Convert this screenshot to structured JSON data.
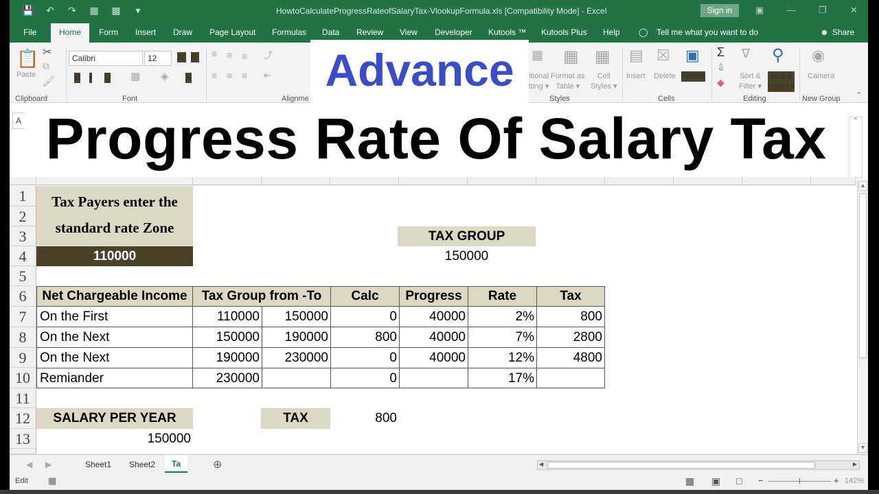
{
  "window": {
    "title": "HowtoCalculateProgressRateofSalaryTax-VlookupFormula.xls  [Compatibility Mode]  -  Excel",
    "sign_in": "Sign in"
  },
  "tabs": [
    "File",
    "Home",
    "Form",
    "Insert",
    "Draw",
    "Page Layout",
    "Formulas",
    "Data",
    "Review",
    "View",
    "Developer",
    "Kutools ™",
    "Kutools Plus",
    "Help"
  ],
  "tell_me": "Tell me what you want to do",
  "share": "Share",
  "ribbon": {
    "paste": "Paste",
    "font_name": "Calibri",
    "font_size": "12",
    "bold": "B",
    "italic": "I",
    "underline": "U",
    "groups": {
      "clipboard": "Clipboard",
      "font": "Font",
      "alignment": "Alignme",
      "styles": "Styles",
      "cells": "Cells",
      "editing": "Editing",
      "new_group": "New Group"
    },
    "conditional": [
      "itional",
      "tting ▾"
    ],
    "format_as_table": [
      "Format as",
      "Table ▾"
    ],
    "cell_styles": [
      "Cell",
      "Styles ▾"
    ],
    "insert": "Insert",
    "delete": "Delete",
    "format": "Format",
    "sort_filter": [
      "Sort &",
      "Filter ▾"
    ],
    "find_select": [
      "Find &",
      "Select ▾"
    ],
    "camera": "Camera"
  },
  "overlay": {
    "advance": "Advance",
    "title": "Progress Rate Of Salary Tax"
  },
  "namebox": "A",
  "rows": [
    "1",
    "2",
    "3",
    "4",
    "5",
    "6",
    "7",
    "8",
    "9",
    "10",
    "11",
    "12",
    "13"
  ],
  "sheet": {
    "intro": [
      "Tax Payers enter the",
      "standard rate Zone"
    ],
    "standard_rate": "110000",
    "tax_group_label": "TAX GROUP",
    "tax_group_value": "150000",
    "table": {
      "headers": [
        "Net Chargeable Income",
        "Tax Group from -To",
        "Calc",
        "Progress",
        "Rate",
        "Tax"
      ],
      "rows": [
        {
          "label": "On the First",
          "from": "110000",
          "to": "150000",
          "calc": "0",
          "progress": "40000",
          "rate": "2%",
          "tax": "800"
        },
        {
          "label": "On the Next",
          "from": "150000",
          "to": "190000",
          "calc": "800",
          "progress": "40000",
          "rate": "7%",
          "tax": "2800"
        },
        {
          "label": "On the Next",
          "from": "190000",
          "to": "230000",
          "calc": "0",
          "progress": "40000",
          "rate": "12%",
          "tax": "4800"
        },
        {
          "label": "Remiander",
          "from": "230000",
          "to": "",
          "calc": "0",
          "progress": "",
          "rate": "17%",
          "tax": ""
        }
      ]
    },
    "salary_label": "SALARY PER YEAR",
    "salary_value": "150000",
    "tax_label": "TAX",
    "tax_value": "800"
  },
  "sheet_tabs": [
    "Sheet1",
    "Sheet2",
    "Ta"
  ],
  "status": {
    "mode": "Edit",
    "zoom": "142%"
  }
}
